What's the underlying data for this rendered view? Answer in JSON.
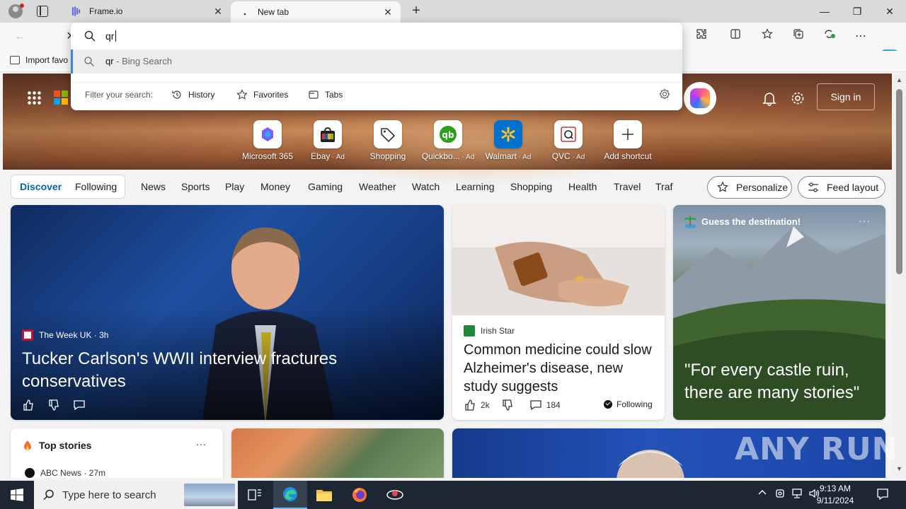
{
  "browser": {
    "tabs": [
      {
        "title": "Frame.io",
        "close": "✕"
      },
      {
        "title": "New tab",
        "close": "✕"
      }
    ],
    "new_tab": "+",
    "window_controls": {
      "minimize": "—",
      "maximize": "❐",
      "close": "✕"
    },
    "toolbar": {
      "back": "←",
      "stop": "✕",
      "more": "⋯"
    },
    "favorites_bar": {
      "import_label": "Import favo"
    }
  },
  "omnibox": {
    "value": "qr",
    "suggestion": {
      "query": "qr",
      "suffix": " - Bing Search"
    },
    "filter_label": "Filter your search:",
    "filters": [
      {
        "label": "History"
      },
      {
        "label": "Favorites"
      },
      {
        "label": "Tabs"
      }
    ]
  },
  "hero": {
    "sign_in": "Sign in",
    "shortcuts": [
      {
        "label": "Microsoft 365",
        "ad": ""
      },
      {
        "label": "Ebay",
        "ad": " · Ad"
      },
      {
        "label": "Shopping",
        "ad": ""
      },
      {
        "label": "Quickbo...",
        "ad": " · Ad"
      },
      {
        "label": "Walmart",
        "ad": " · Ad"
      },
      {
        "label": "QVC",
        "ad": " · Ad"
      },
      {
        "label": "Add shortcut",
        "ad": ""
      }
    ]
  },
  "feed_nav": {
    "discover": "Discover",
    "following": "Following",
    "links": [
      "News",
      "Sports",
      "Play",
      "Money",
      "Gaming",
      "Weather",
      "Watch",
      "Learning",
      "Shopping",
      "Health",
      "Travel",
      "Traf"
    ],
    "personalize": "Personalize",
    "feed_layout": "Feed layout"
  },
  "cards": {
    "tucker": {
      "source": "The Week UK · 3h",
      "headline": "Tucker Carlson's WWII interview fractures conservatives"
    },
    "medicine": {
      "source": "Irish Star",
      "headline": "Common medicine could slow Alzheimer's disease, new study suggests",
      "likes": "2k",
      "comments": "184",
      "following": "Following"
    },
    "castle": {
      "title": "Guess the destination!",
      "more": "···",
      "quote": "\"For every castle ruin, there are many stories\""
    },
    "top_stories": {
      "title": "Top stories",
      "more": "···",
      "source": "ABC News · 27m"
    }
  },
  "watermark": "ANY RUN",
  "taskbar": {
    "search_placeholder": "Type here to search",
    "time": "9:13 AM",
    "date": "9/11/2024"
  },
  "colors": {
    "accent": "#0067b8",
    "taskbar": "#1c2733",
    "ms_red": "#f25022",
    "ms_green": "#7fba00",
    "ms_blue": "#00a4ef",
    "ms_yellow": "#ffb900"
  }
}
